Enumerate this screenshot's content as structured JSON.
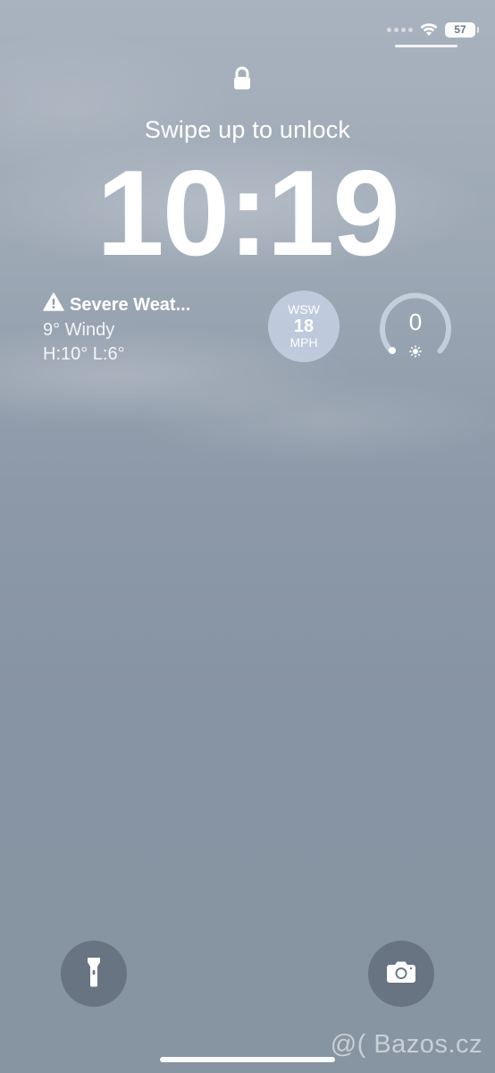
{
  "status_bar": {
    "battery_level": "57"
  },
  "lock_screen": {
    "unlock_hint": "Swipe up to unlock",
    "time": "10:19"
  },
  "weather": {
    "alert": "Severe Weat...",
    "condition": "9° Windy",
    "high_low": "H:10° L:6°"
  },
  "wind": {
    "direction": "WSW",
    "speed": "18",
    "unit": "MPH"
  },
  "uv_index": {
    "value": "0"
  },
  "watermark": {
    "text": "@( Bazos.cz"
  },
  "icons": {
    "status": [
      "signal-dots-icon",
      "wifi-icon",
      "battery-icon"
    ],
    "lock": "lock-icon",
    "alert": "warning-triangle-icon",
    "uv": "sun-icon",
    "buttons": [
      "flashlight-icon",
      "camera-icon"
    ]
  }
}
